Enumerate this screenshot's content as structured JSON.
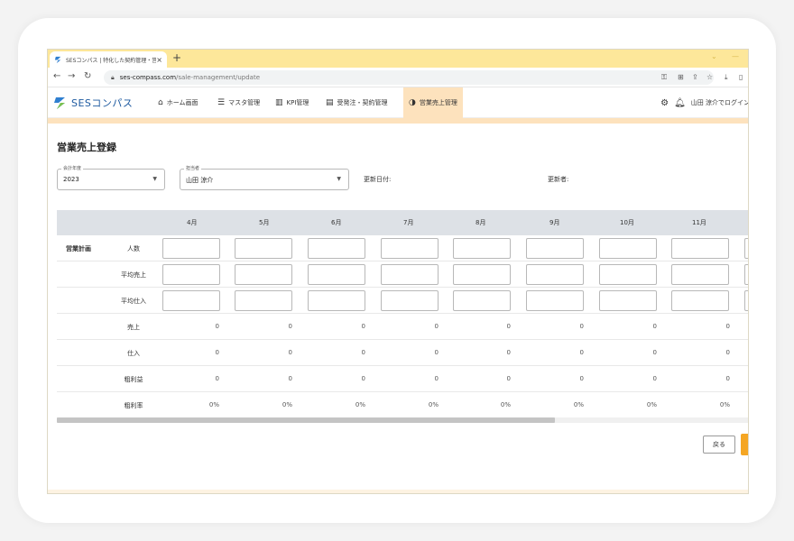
{
  "browser": {
    "tab_title": "SESコンパス | 特化した契約管理・営",
    "tab_close": "×",
    "new_tab": "+",
    "win_min": "⌄",
    "win_max": "—",
    "url_host": "ses-compass.com",
    "url_path": "/sale-management/update"
  },
  "header": {
    "logo_text": "SESコンパス",
    "menu": [
      {
        "label": "ホーム画面",
        "icon": "home-icon"
      },
      {
        "label": "マスタ管理",
        "icon": "database-icon"
      },
      {
        "label": "KPI管理",
        "icon": "bar-chart-icon"
      },
      {
        "label": "受発注・契約管理",
        "icon": "document-icon"
      },
      {
        "label": "営業売上管理",
        "icon": "pie-chart-icon"
      }
    ],
    "user_label": "山田 涼介でログイン"
  },
  "page": {
    "title": "営業売上登録",
    "fiscal_year_label": "会計年度",
    "fiscal_year_value": "2023",
    "owner_label": "担当者",
    "owner_value": "山田 涼介",
    "updated_date_label": "更新日付:",
    "updated_by_label": "更新者:"
  },
  "table": {
    "months": [
      "4月",
      "5月",
      "6月",
      "7月",
      "8月",
      "9月",
      "10月",
      "11月"
    ],
    "group_label": "営業計画",
    "input_rows": [
      "人数",
      "平均売上",
      "平均仕入"
    ],
    "value_rows": [
      {
        "label": "売上",
        "values": [
          "0",
          "0",
          "0",
          "0",
          "0",
          "0",
          "0",
          "0"
        ]
      },
      {
        "label": "仕入",
        "values": [
          "0",
          "0",
          "0",
          "0",
          "0",
          "0",
          "0",
          "0"
        ]
      },
      {
        "label": "粗利益",
        "values": [
          "0",
          "0",
          "0",
          "0",
          "0",
          "0",
          "0",
          "0"
        ]
      },
      {
        "label": "粗利率",
        "values": [
          "0%",
          "0%",
          "0%",
          "0%",
          "0%",
          "0%",
          "0%",
          "0%"
        ]
      }
    ]
  },
  "actions": {
    "back_label": "戻る"
  },
  "colors": {
    "accent": "#f5a623",
    "tabbar": "#fde79a",
    "active_menu": "#fde2bd",
    "table_header": "#dde1e6"
  }
}
